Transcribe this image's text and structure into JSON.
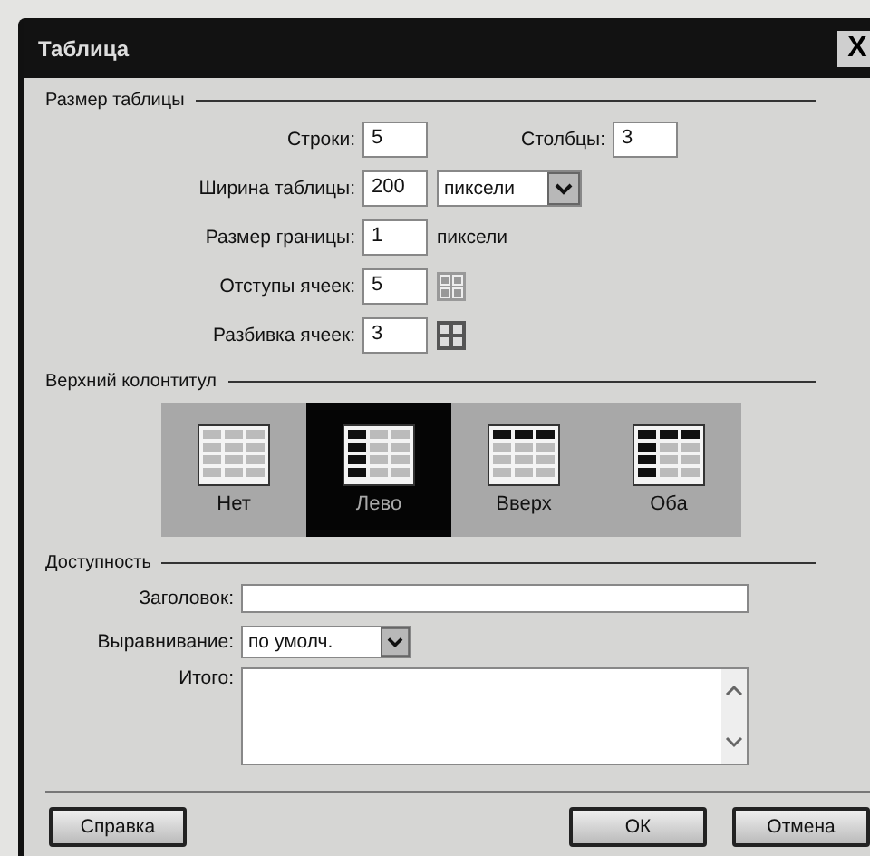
{
  "window": {
    "title": "Таблица",
    "close": "X"
  },
  "table_size": {
    "heading": "Размер таблицы",
    "rows": {
      "label": "Строки:",
      "value": "5"
    },
    "columns": {
      "label": "Столбцы:",
      "value": "3"
    },
    "width": {
      "label": "Ширина таблицы:",
      "value": "200",
      "unit": "пиксели"
    },
    "border": {
      "label": "Размер границы:",
      "value": "1",
      "unit": "пиксели"
    },
    "padding": {
      "label": "Отступы ячеек:",
      "value": "5"
    },
    "spacing": {
      "label": "Разбивка ячеек:",
      "value": "3"
    }
  },
  "header": {
    "heading": "Верхний колонтитул",
    "options": [
      {
        "kind": "none",
        "label": "Нет",
        "selected": false
      },
      {
        "kind": "left",
        "label": "Лево",
        "selected": true
      },
      {
        "kind": "top",
        "label": "Вверх",
        "selected": false
      },
      {
        "kind": "both",
        "label": "Оба",
        "selected": false
      }
    ]
  },
  "accessibility": {
    "heading": "Доступность",
    "caption": {
      "label": "Заголовок:"
    },
    "align": {
      "label": "Выравнивание:",
      "value": "по умолч."
    },
    "summary": {
      "label": "Итого:"
    }
  },
  "buttons": {
    "help": "Справка",
    "ok": "ОК",
    "cancel": "Отмена"
  }
}
